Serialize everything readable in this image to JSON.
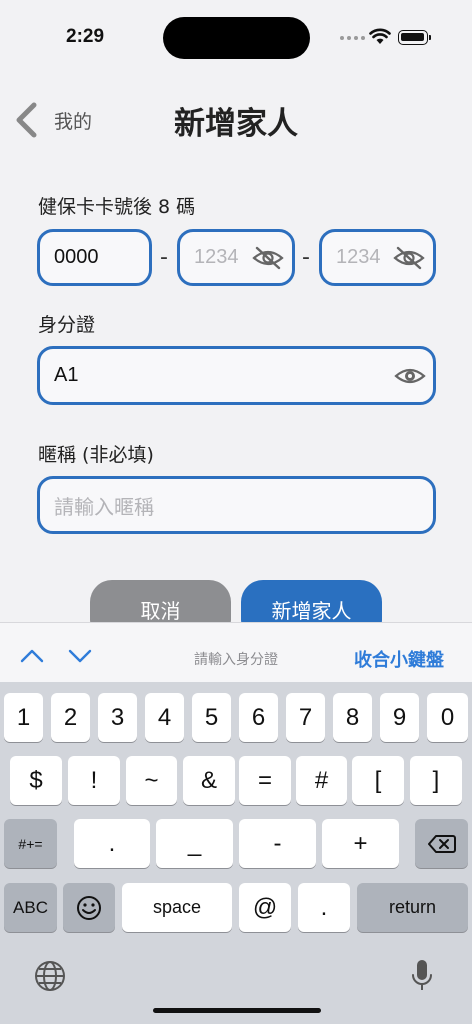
{
  "status_bar": {
    "time": "2:29"
  },
  "nav": {
    "back_label": "我的",
    "title": "新增家人"
  },
  "card": {
    "label": "健保卡卡號後 8 碼",
    "field1_value": "0000",
    "dash": "-",
    "field2_placeholder": "1234",
    "field3_placeholder": "1234"
  },
  "id_card": {
    "label": "身分證",
    "value": "A1"
  },
  "nickname": {
    "label": "暱稱 (非必填)",
    "placeholder": "請輸入暱稱"
  },
  "buttons": {
    "cancel": "取消",
    "add": "新增家人"
  },
  "accessory": {
    "hint": "請輸入身分證",
    "done": "收合小鍵盤"
  },
  "keyboard": {
    "row1": [
      "1",
      "2",
      "3",
      "4",
      "5",
      "6",
      "7",
      "8",
      "9",
      "0"
    ],
    "row2": [
      "$",
      "!",
      "~",
      "&",
      "=",
      "#",
      "[",
      "]"
    ],
    "row3": {
      "shift": "#+=",
      "keys": [
        ".",
        "_",
        "-",
        "+"
      ]
    },
    "row4": {
      "abc": "ABC",
      "space": "space",
      "at": "@",
      "dot": ".",
      "return": "return"
    }
  },
  "colors": {
    "accent": "#2a70c0",
    "field_border": "#2d6fbe",
    "cancel": "#8d8e91",
    "link": "#2f7cd9"
  }
}
